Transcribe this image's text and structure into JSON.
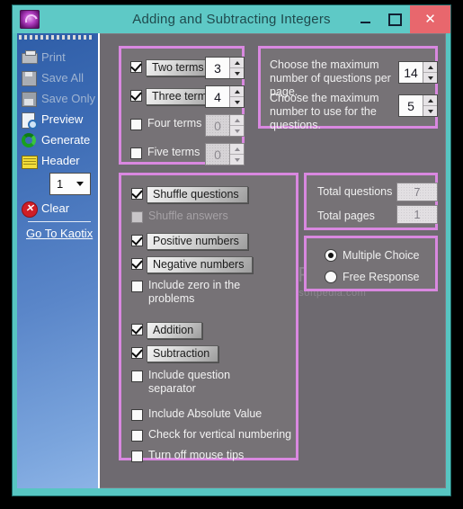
{
  "window": {
    "title": "Adding and Subtracting Integers",
    "icon": "app-logo-icon",
    "minimize_label": "Minimize",
    "maximize_label": "Maximize",
    "close_label": "Close"
  },
  "sidebar": {
    "items": [
      {
        "label": "Print",
        "icon": "printer-icon",
        "enabled": false
      },
      {
        "label": "Save All",
        "icon": "floppy-icon",
        "enabled": false
      },
      {
        "label": "Save Only",
        "icon": "floppy-one-icon",
        "enabled": false
      },
      {
        "label": "Preview",
        "icon": "preview-icon",
        "enabled": true
      },
      {
        "label": "Generate",
        "icon": "recycle-icon",
        "enabled": true
      },
      {
        "label": "Header",
        "icon": "header-icon",
        "enabled": true
      },
      {
        "label": "Clear",
        "icon": "red-x-icon",
        "enabled": true
      }
    ],
    "header_count": {
      "value": "1"
    },
    "link": "Go To Kaotix"
  },
  "terms_panel": {
    "rows": [
      {
        "label": "Two terms",
        "checked": true,
        "value": "3",
        "enabled": true
      },
      {
        "label": "Three terms",
        "checked": true,
        "value": "4",
        "enabled": true
      },
      {
        "label": "Four terms",
        "checked": false,
        "value": "0",
        "enabled": false
      },
      {
        "label": "Five terms",
        "checked": false,
        "value": "0",
        "enabled": false
      }
    ]
  },
  "maximums_panel": {
    "rows": [
      {
        "text": "Choose the maximum number of questions per page.",
        "value": "14"
      },
      {
        "text": "Choose the maximum number to use for the questions.",
        "value": "5"
      }
    ]
  },
  "options_panel": {
    "options": [
      {
        "label": "Shuffle questions",
        "checked": true,
        "enabled": true
      },
      {
        "label": "Shuffle answers",
        "checked": false,
        "enabled": false
      },
      {
        "label": "Positive numbers",
        "checked": true,
        "enabled": true
      },
      {
        "label": "Negative numbers",
        "checked": true,
        "enabled": true
      },
      {
        "label": "Include zero in the problems",
        "checked": false,
        "enabled": true
      },
      {
        "label": "Addition",
        "checked": true,
        "enabled": true
      },
      {
        "label": "Subtraction",
        "checked": true,
        "enabled": true
      },
      {
        "label": "Include question separator",
        "checked": false,
        "enabled": true
      },
      {
        "label": "Include Absolute Value",
        "checked": false,
        "enabled": true
      },
      {
        "label": "Check for vertical numbering",
        "checked": false,
        "enabled": true
      },
      {
        "label": "Turn off mouse tips",
        "checked": false,
        "enabled": true
      }
    ]
  },
  "totals_panel": {
    "questions_label": "Total questions",
    "questions_value": "7",
    "pages_label": "Total pages",
    "pages_value": "1"
  },
  "format_panel": {
    "options": [
      {
        "label": "Multiple Choice",
        "selected": true
      },
      {
        "label": "Free Response",
        "selected": false
      }
    ]
  },
  "watermark": {
    "brand": "SOFTPEDIA",
    "tm": "™",
    "url": "www.softpedia.com"
  },
  "colors": {
    "titlebar": "#5ec9c6",
    "close_button": "#e8676d",
    "panel_border": "#d988e0",
    "client_background": "#6e6a70",
    "sidebar_blue": "#3c6bb4"
  }
}
